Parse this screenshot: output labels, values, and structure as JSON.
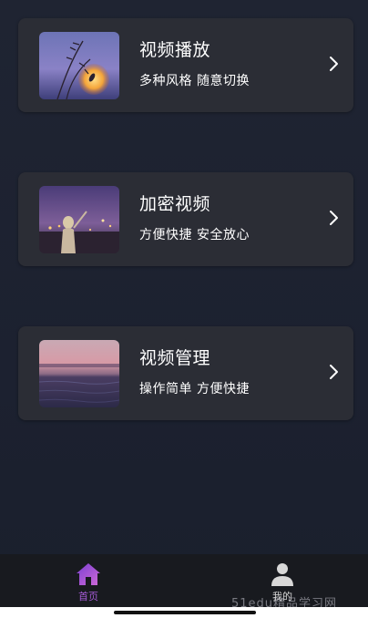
{
  "cards": [
    {
      "title": "视频播放",
      "subtitle": "多种风格 随意切换",
      "image": "moonlit-grass-thumbnail"
    },
    {
      "title": "加密视频",
      "subtitle": "方便快捷 安全放心",
      "image": "night-city-woman-thumbnail"
    },
    {
      "title": "视频管理",
      "subtitle": "操作简单 方便快捷",
      "image": "sunset-sea-thumbnail"
    }
  ],
  "icons": {
    "chevron": "chevron-right-icon",
    "home": "home-icon",
    "profile": "person-icon"
  },
  "tabbar": {
    "home_label": "首页",
    "mine_label": "我的",
    "active_color": "#a55bd6"
  },
  "watermark": "51edu精品学习网",
  "colors": {
    "background": "#1d2230",
    "card": "#2b2d35",
    "text": "#ffffff",
    "accent": "#a55bd6"
  }
}
